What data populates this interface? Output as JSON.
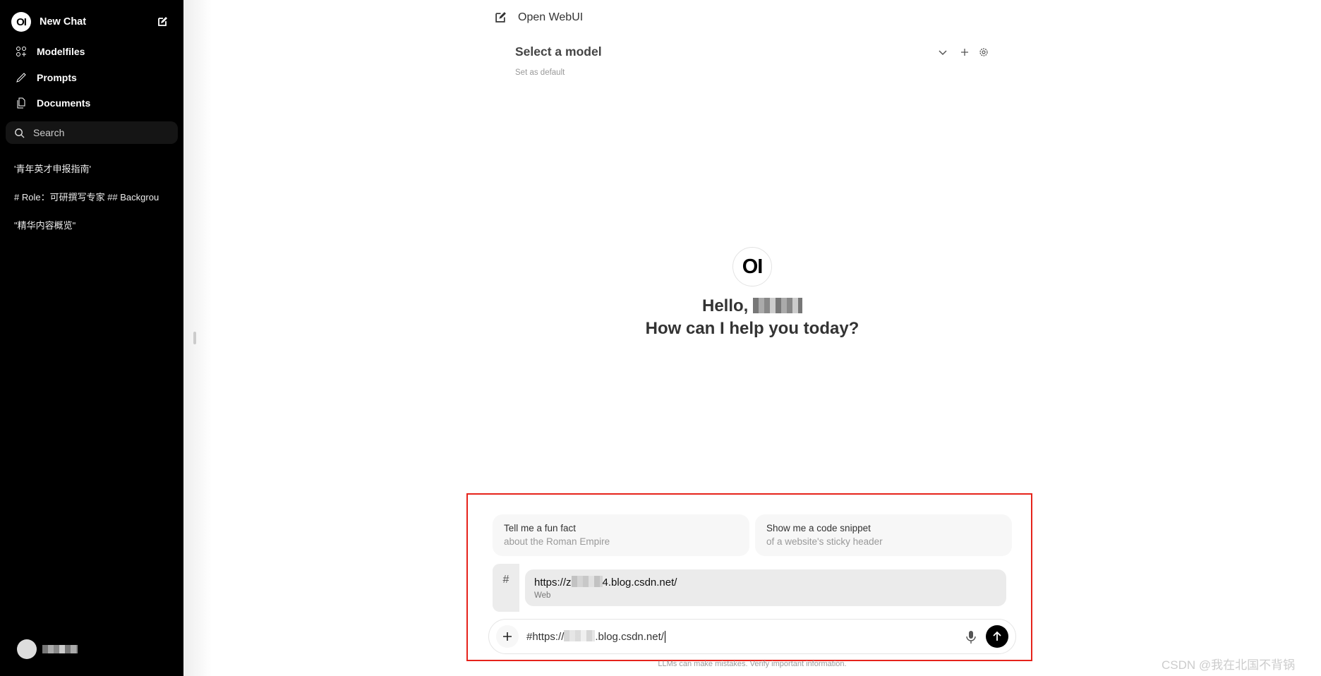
{
  "sidebar": {
    "new_chat": "New Chat",
    "logo": "OI",
    "items": [
      {
        "label": "Modelfiles",
        "icon": "modelfiles-icon"
      },
      {
        "label": "Prompts",
        "icon": "pencil-icon"
      },
      {
        "label": "Documents",
        "icon": "documents-icon"
      }
    ],
    "search_placeholder": "Search",
    "chats": [
      "'青年英才申报指南'",
      "# Role：可研撰写专家 ## Backgrou",
      "\"精华内容概览\""
    ]
  },
  "header": {
    "title": "Open WebUI",
    "model_select": "Select a model",
    "set_default": "Set as default"
  },
  "main": {
    "logo": "OI",
    "hello": "Hello,",
    "subtitle": "How can I help you today?"
  },
  "suggestions": [
    {
      "title": "Tell me a fun fact",
      "subtitle": "about the Roman Empire"
    },
    {
      "title": "Show me a code snippet",
      "subtitle": "of a website's sticky header"
    }
  ],
  "hash": {
    "symbol": "#",
    "url_prefix": "https://z",
    "url_suffix": "4.blog.csdn.net/",
    "type": "Web"
  },
  "input": {
    "prefix": "#https://",
    "suffix": ".blog.csdn.net/"
  },
  "footer": "LLMs can make mistakes. Verify important information.",
  "watermark": "CSDN @我在北国不背锅",
  "colors": {
    "sidebar_bg": "#000000",
    "highlight_border": "#e6231b"
  }
}
